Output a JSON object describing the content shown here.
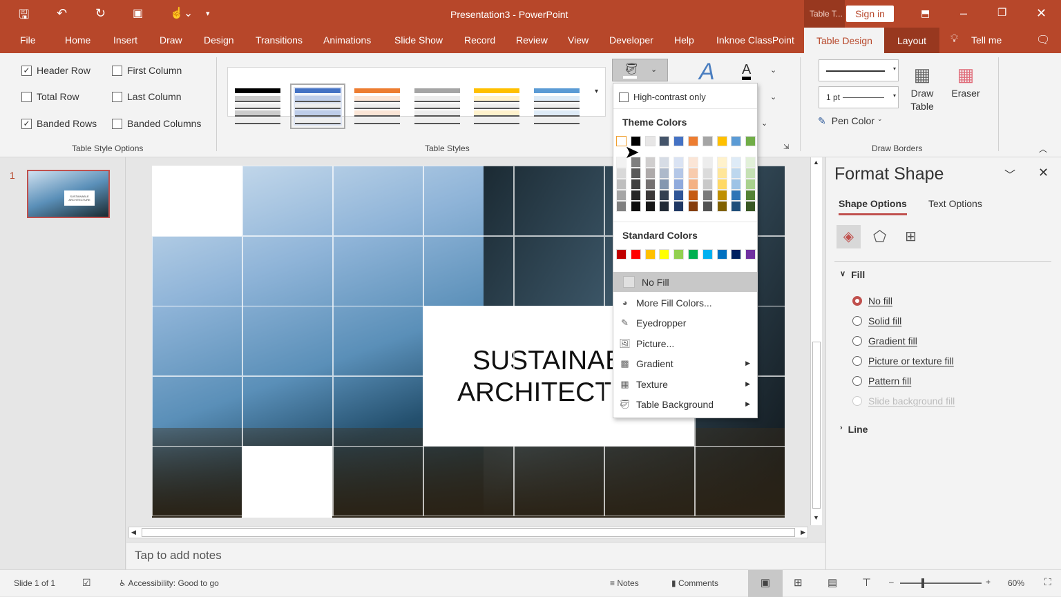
{
  "title": "Presentation3  -  PowerPoint",
  "context_tab": "Table T...",
  "sign_in": "Sign in",
  "tabs": [
    "File",
    "Home",
    "Insert",
    "Draw",
    "Design",
    "Transitions",
    "Animations",
    "Slide Show",
    "Record",
    "Review",
    "View",
    "Developer",
    "Help",
    "Inknoe ClassPoint",
    "Table Design",
    "Layout"
  ],
  "tell_me": "Tell me",
  "style_options": {
    "header_row": "Header Row",
    "first_column": "First Column",
    "total_row": "Total Row",
    "last_column": "Last Column",
    "banded_rows": "Banded Rows",
    "banded_columns": "Banded Columns",
    "group": "Table Style Options",
    "checked": {
      "header_row": true,
      "first_column": false,
      "total_row": false,
      "last_column": false,
      "banded_rows": true,
      "banded_columns": false
    }
  },
  "table_styles": {
    "group": "Table Styles",
    "accents": [
      "#000000",
      "#4472c4",
      "#ed7d31",
      "#a5a5a5",
      "#ffc000",
      "#5b9bd5"
    ]
  },
  "draw_borders": {
    "weight": "1 pt",
    "pen_color": "Pen Color",
    "draw_table_1": "Draw",
    "draw_table_2": "Table",
    "eraser": "Eraser",
    "group": "Draw Borders"
  },
  "dropdown": {
    "high_contrast": "High-contrast only",
    "theme_label": "Theme Colors",
    "theme": [
      "#FFFFFF",
      "#000000",
      "#E7E6E6",
      "#44546A",
      "#4472C4",
      "#ED7D31",
      "#A5A5A5",
      "#FFC000",
      "#5B9BD5",
      "#70AD47"
    ],
    "shades": [
      [
        "#F2F2F2",
        "#D9D9D9",
        "#BFBFBF",
        "#A6A6A6",
        "#808080"
      ],
      [
        "#7F7F7F",
        "#595959",
        "#404040",
        "#262626",
        "#0D0D0D"
      ],
      [
        "#D0CECE",
        "#AEAAAA",
        "#757171",
        "#3B3838",
        "#161616"
      ],
      [
        "#D6DCE5",
        "#ADB9CA",
        "#8497B0",
        "#333F50",
        "#222A35"
      ],
      [
        "#DAE3F3",
        "#B4C7E7",
        "#8FAADC",
        "#2F5597",
        "#1F3864"
      ],
      [
        "#FBE5D6",
        "#F8CBAD",
        "#F4B183",
        "#C55A11",
        "#843C0C"
      ],
      [
        "#EDEDED",
        "#DBDBDB",
        "#C9C9C9",
        "#7B7B7B",
        "#525252"
      ],
      [
        "#FFF2CC",
        "#FFE699",
        "#FFD966",
        "#BF9000",
        "#7F6000"
      ],
      [
        "#DEEBF7",
        "#BDD7EE",
        "#9DC3E6",
        "#2E75B6",
        "#1F4E79"
      ],
      [
        "#E2F0D9",
        "#C5E0B4",
        "#A9D18E",
        "#548235",
        "#385723"
      ]
    ],
    "standard_label": "Standard Colors",
    "standard": [
      "#C00000",
      "#FF0000",
      "#FFC000",
      "#FFFF00",
      "#92D050",
      "#00B050",
      "#00B0F0",
      "#0070C0",
      "#002060",
      "#7030A0"
    ],
    "items": [
      "No Fill",
      "More Fill Colors...",
      "Eyedropper",
      "Picture...",
      "Gradient",
      "Texture",
      "Table Background"
    ]
  },
  "slide": {
    "number": "1",
    "text_line1": "SUSTAINABLE",
    "text_line2": "ARCHITECTURE",
    "thumb_text": "SUSTAINABLE ARCHITECTURE"
  },
  "notes_placeholder": "Tap to add notes",
  "pane": {
    "title": "Format Shape",
    "tab_shape": "Shape Options",
    "tab_text": "Text Options",
    "fill": "Fill",
    "options": [
      "No fill",
      "Solid fill",
      "Gradient fill",
      "Picture or texture fill",
      "Pattern fill",
      "Slide background fill"
    ],
    "selected": 0,
    "line": "Line"
  },
  "status": {
    "slide": "Slide 1 of 1",
    "accessibility": "Accessibility: Good to go",
    "notes": "Notes",
    "comments": "Comments",
    "zoom": "60%",
    "zoom_percent": 60
  }
}
